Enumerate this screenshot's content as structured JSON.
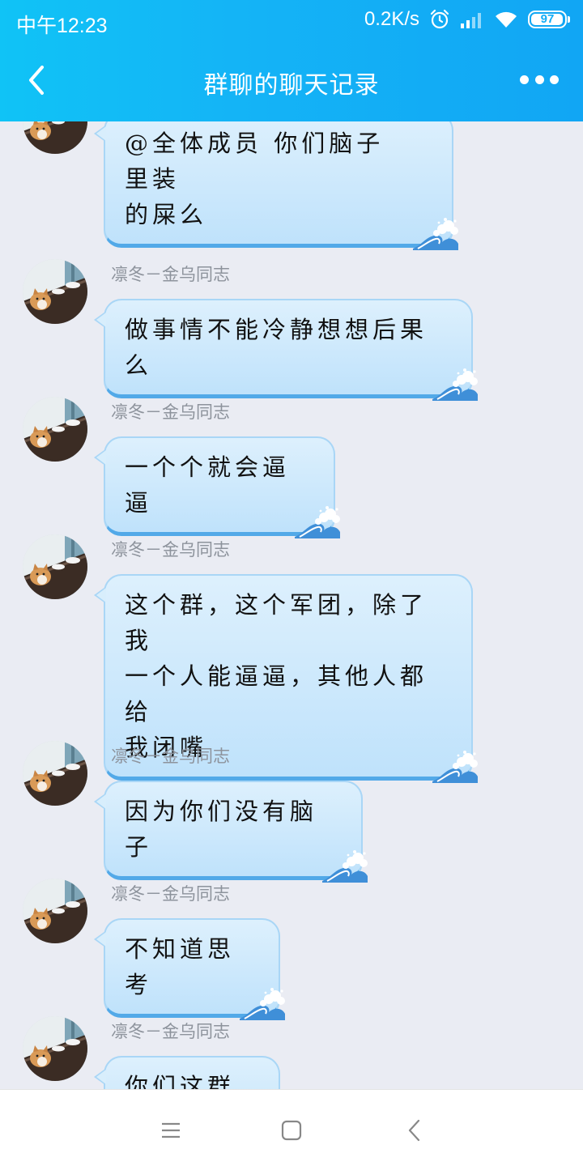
{
  "status_bar": {
    "time": "中午12:23",
    "net_speed": "0.2K/s",
    "battery": "97",
    "battery_level": 0.97,
    "icons": [
      "alarm-icon",
      "signal-icon",
      "wifi-icon",
      "battery-icon"
    ]
  },
  "header": {
    "title": "群聊的聊天记录",
    "back_icon": "chevron-left-icon",
    "more_icon": "more-dots-icon"
  },
  "messages": [
    {
      "sender": "",
      "lines": [
        "@全体成员 你们脑子里装",
        "的屎么"
      ]
    },
    {
      "sender": "凛冬－金乌同志",
      "lines": [
        "做事情不能冷静想想后果么"
      ]
    },
    {
      "sender": "凛冬－金乌同志",
      "lines": [
        "一个个就会逼逼"
      ]
    },
    {
      "sender": "凛冬－金乌同志",
      "lines": [
        "这个群，这个军团，除了我",
        "一个人能逼逼，其他人都给",
        "我闭嘴"
      ]
    },
    {
      "sender": "凛冬－金乌同志",
      "lines": [
        "因为你们没有脑子"
      ]
    },
    {
      "sender": "凛冬－金乌同志",
      "lines": [
        "不知道思考"
      ]
    },
    {
      "sender": "凛冬－金乌同志",
      "lines": [
        "你们这群猪"
      ]
    }
  ],
  "colors": {
    "header_gradient_start": "#10c3f6",
    "header_gradient_end": "#11a6f4",
    "background": "#eaecf3",
    "bubble_fill": "#cfe9fc",
    "bubble_border": "#52a9e8",
    "sender_name": "#8d939c"
  },
  "system_nav": {
    "icons": [
      "menu-icon",
      "home-square-icon",
      "back-triangle-icon"
    ]
  }
}
